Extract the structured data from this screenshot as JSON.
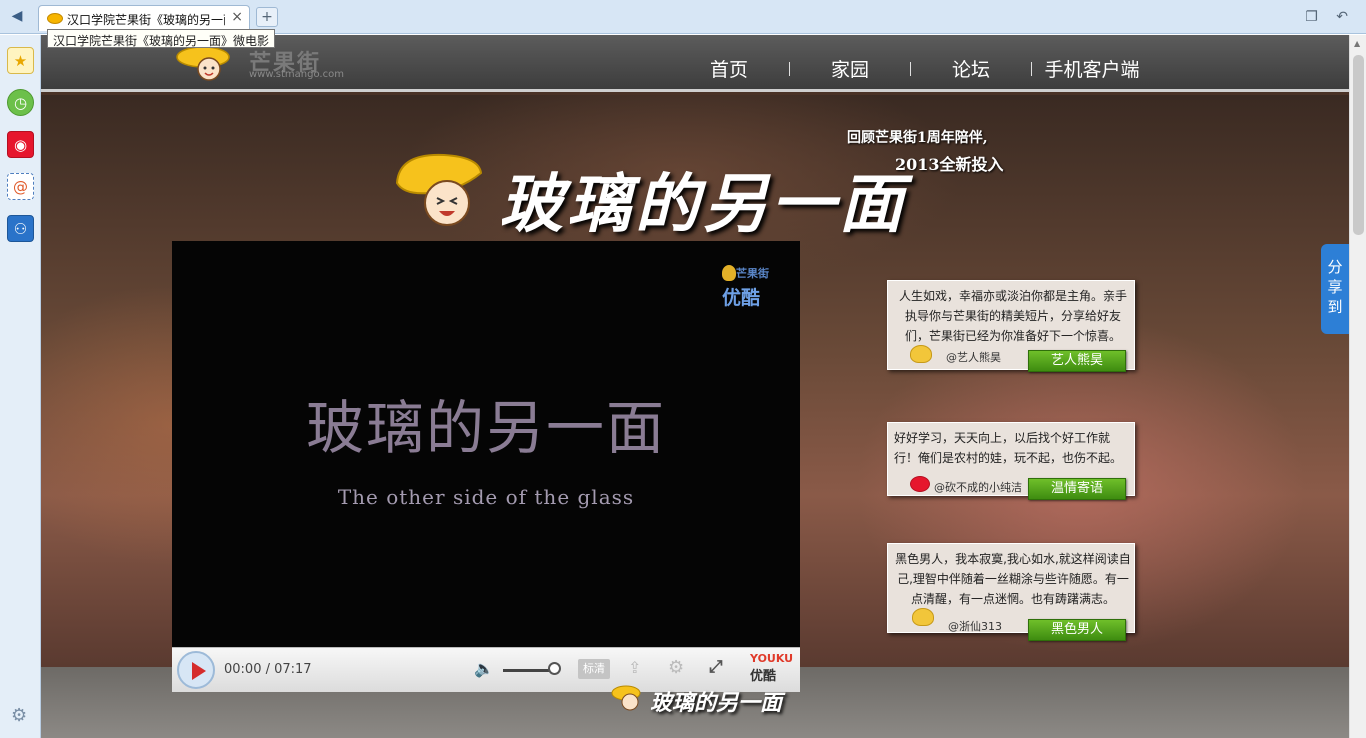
{
  "browser": {
    "tab_title": "汉口学院芒果街《玻璃的另一面》微电影",
    "tooltip": "汉口学院芒果街《玻璃的另一面》微电影",
    "new_tab_label": "+",
    "close_label": "×",
    "back_label": "◀",
    "right_icons": [
      "restore-icon",
      "undo-icon"
    ]
  },
  "sidebar": {
    "items": [
      {
        "icon": "favorites-star-icon"
      },
      {
        "icon": "history-clock-icon"
      },
      {
        "icon": "weibo-icon"
      },
      {
        "icon": "mail-icon"
      },
      {
        "icon": "contacts-icon"
      }
    ],
    "settings_icon": "gear-icon"
  },
  "site": {
    "logo_text": "芒果街",
    "logo_url": "www.stmango.com",
    "nav": [
      "首页",
      "家园",
      "论坛",
      "手机客户端"
    ],
    "hero_title": "玻璃的另一面",
    "tagline_line1": "回顾芒果街1周年陪伴,",
    "tagline_line2": "2013全新投入",
    "footer_title": "玻璃的另一面"
  },
  "player": {
    "watermark_top": "芒果街",
    "watermark_bottom": "优酷",
    "video_title": "玻璃的另一面",
    "video_subtitle": "The other side of the glass",
    "time": "00:00 / 07:17",
    "quality_label": "标清",
    "youku_en": "YOUKU",
    "youku_cn": "优酷",
    "volume_level": 0.9
  },
  "cards": [
    {
      "text": "人生如戏，幸福亦或淡泊你都是主角。亲手执导你与芒果街的精美短片，分享给好友们，芒果街已经为你准备好下一个惊喜。",
      "author": "@艺人熊昊",
      "button": "艺人熊昊"
    },
    {
      "text": "好好学习，天天向上，以后找个好工作就行！俺们是农村的娃，玩不起，也伤不起。",
      "author": "@砍不成的小纯洁",
      "button": "温情寄语"
    },
    {
      "text": "黑色男人，我本寂寞,我心如水,就这样阅读自己,理智中伴随着一丝糊涂与些许随愿。有一点清醒，有一点迷惘。也有踌躇满志。",
      "author": "@浙仙313",
      "button": "黑色男人"
    }
  ],
  "share": {
    "label_chars": [
      "分",
      "享",
      "到"
    ]
  },
  "colors": {
    "card_button": "#4a9a18",
    "share_tab": "#2d7fd6",
    "header_bg": "#4a4a4a"
  }
}
